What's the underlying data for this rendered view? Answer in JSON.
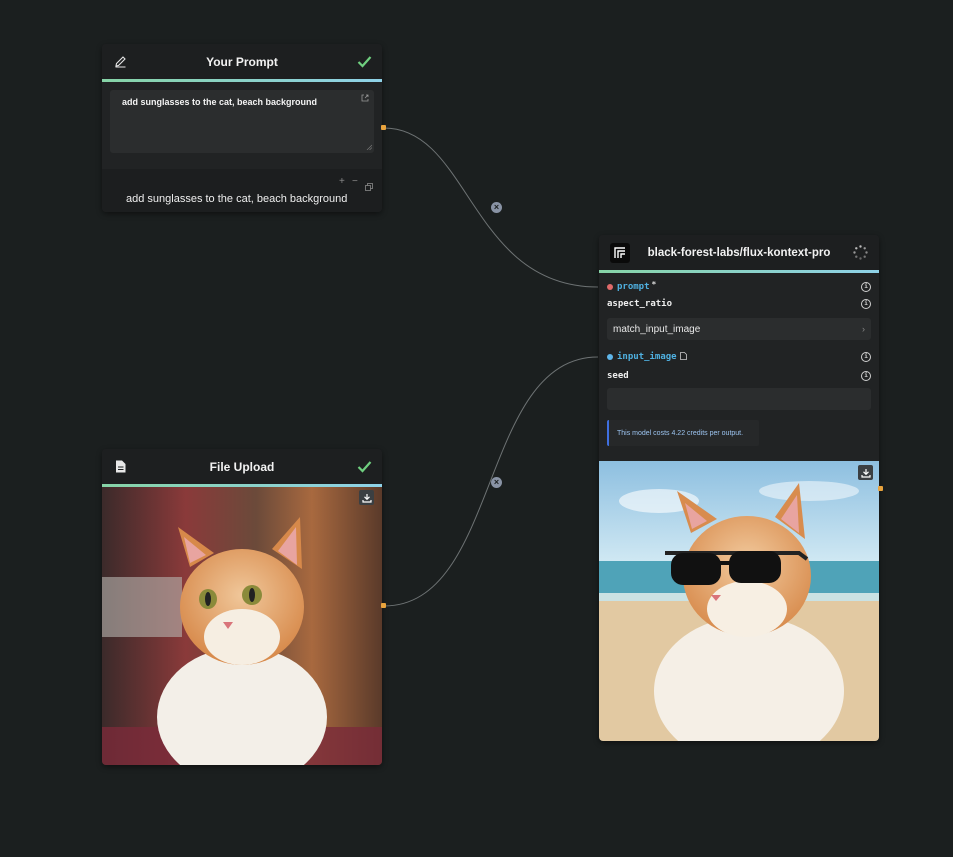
{
  "nodes": {
    "prompt": {
      "title": "Your Prompt",
      "text": "add sunglasses to the cat, beach background",
      "preview": "add sunglasses to the cat, beach background"
    },
    "upload": {
      "title": "File Upload"
    },
    "model": {
      "title": "black-forest-labs/flux-kontext-pro",
      "params": {
        "prompt_label": "prompt",
        "prompt_required": "*",
        "aspect_ratio_label": "aspect_ratio",
        "aspect_ratio_value": "match_input_image",
        "input_image_label": "input_image",
        "seed_label": "seed",
        "seed_value": ""
      },
      "cost_note": "This model costs 4.22 credits per output."
    }
  },
  "colors": {
    "canvas": "#1b1f1f",
    "node_bg": "#212324",
    "accent_green": "#86d3a6",
    "accent_blue": "#8fd2e8",
    "port": "#e8a33d",
    "param_link": "#4fb0e0",
    "note_border": "#3f6fe0"
  },
  "icons": {
    "prompt_header": "pencil-icon",
    "prompt_status": "check-icon",
    "upload_header": "document-icon",
    "upload_status": "check-icon",
    "model_header": "replicate-logo",
    "model_status": "loading-spinner-icon",
    "download": "download-icon"
  }
}
